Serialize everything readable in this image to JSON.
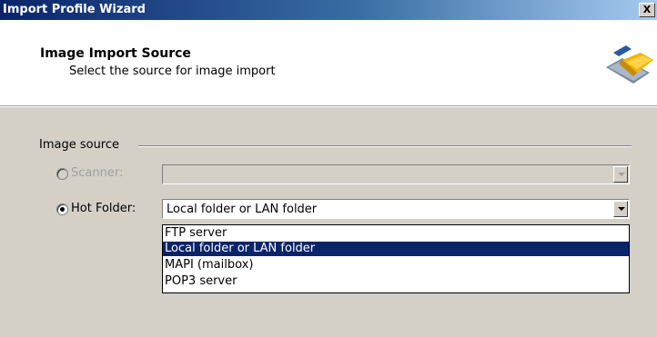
{
  "window": {
    "title": "Import Profile Wizard",
    "close_glyph": "X"
  },
  "header": {
    "title": "Image Import Source",
    "subtitle": "Select the source for image import",
    "icon": "scanner-folder-icon"
  },
  "group": {
    "label": "Image source"
  },
  "scanner": {
    "label": "Scanner:",
    "enabled": false,
    "selected": false,
    "value": ""
  },
  "hot_folder": {
    "label": "Hot Folder:",
    "enabled": true,
    "selected": true,
    "value": "Local folder or LAN folder"
  },
  "dropdown": {
    "options": [
      "FTP server",
      "Local folder or LAN folder",
      "MAPI (mailbox)",
      "POP3 server"
    ],
    "selected_index": 1
  },
  "colors": {
    "title_start": "#0a246a",
    "title_end": "#a6caf0",
    "face": "#d4d0c8",
    "highlight": "#0a246a"
  }
}
